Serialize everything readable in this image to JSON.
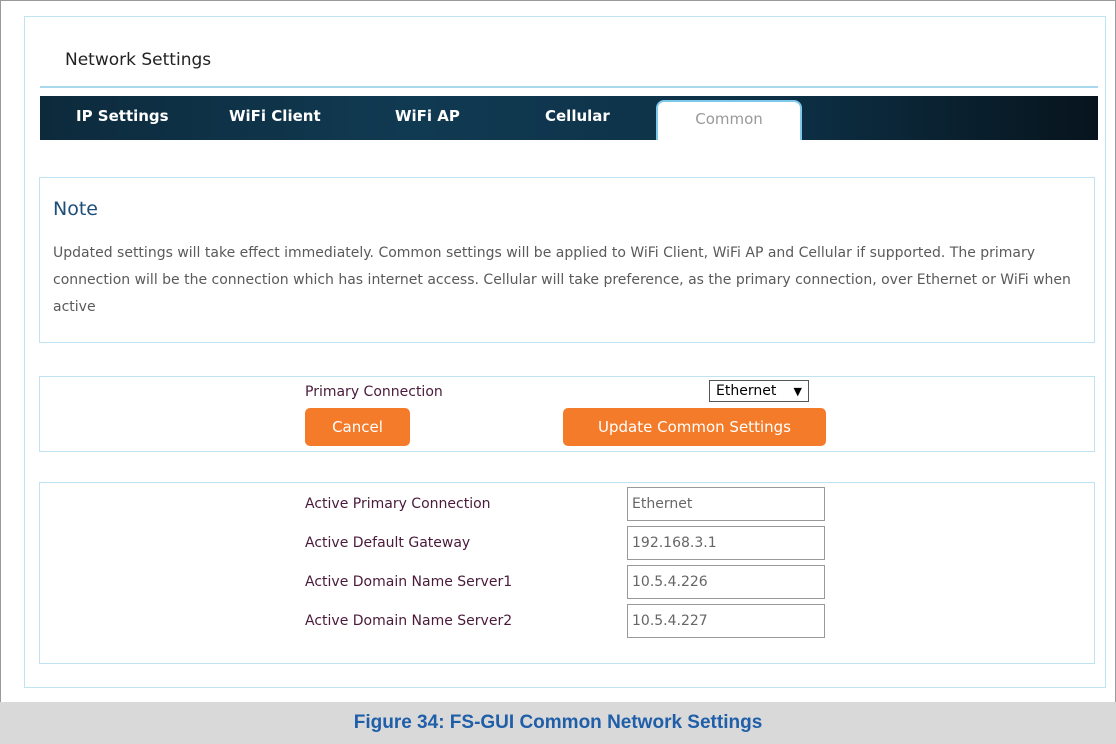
{
  "page": {
    "title": "Network Settings"
  },
  "tabs": [
    {
      "label": "IP Settings"
    },
    {
      "label": "WiFi Client"
    },
    {
      "label": "WiFi AP"
    },
    {
      "label": "Cellular"
    },
    {
      "label": "Common"
    }
  ],
  "note": {
    "title": "Note",
    "text": "Updated settings will take effect immediately. Common settings will be applied to WiFi Client, WiFi AP and Cellular if supported. The primary connection will be the connection which has internet access. Cellular will take preference, as the primary connection, over Ethernet or WiFi when active"
  },
  "form": {
    "primary_connection_label": "Primary Connection",
    "primary_connection_value": "Ethernet",
    "cancel_label": "Cancel",
    "update_label": "Update Common Settings"
  },
  "status": {
    "rows": [
      {
        "label": "Active Primary Connection",
        "value": "Ethernet"
      },
      {
        "label": "Active Default Gateway",
        "value": "192.168.3.1"
      },
      {
        "label": "Active Domain Name Server1",
        "value": "10.5.4.226"
      },
      {
        "label": "Active Domain Name Server2",
        "value": "10.5.4.227"
      }
    ]
  },
  "caption": "Figure 34: FS-GUI Common Network Settings",
  "colors": {
    "accent_orange": "#f37b2a",
    "tabbar_dark": "#0d2a3c",
    "panel_border": "#bfe3f3",
    "caption_blue": "#1f5ea8"
  }
}
